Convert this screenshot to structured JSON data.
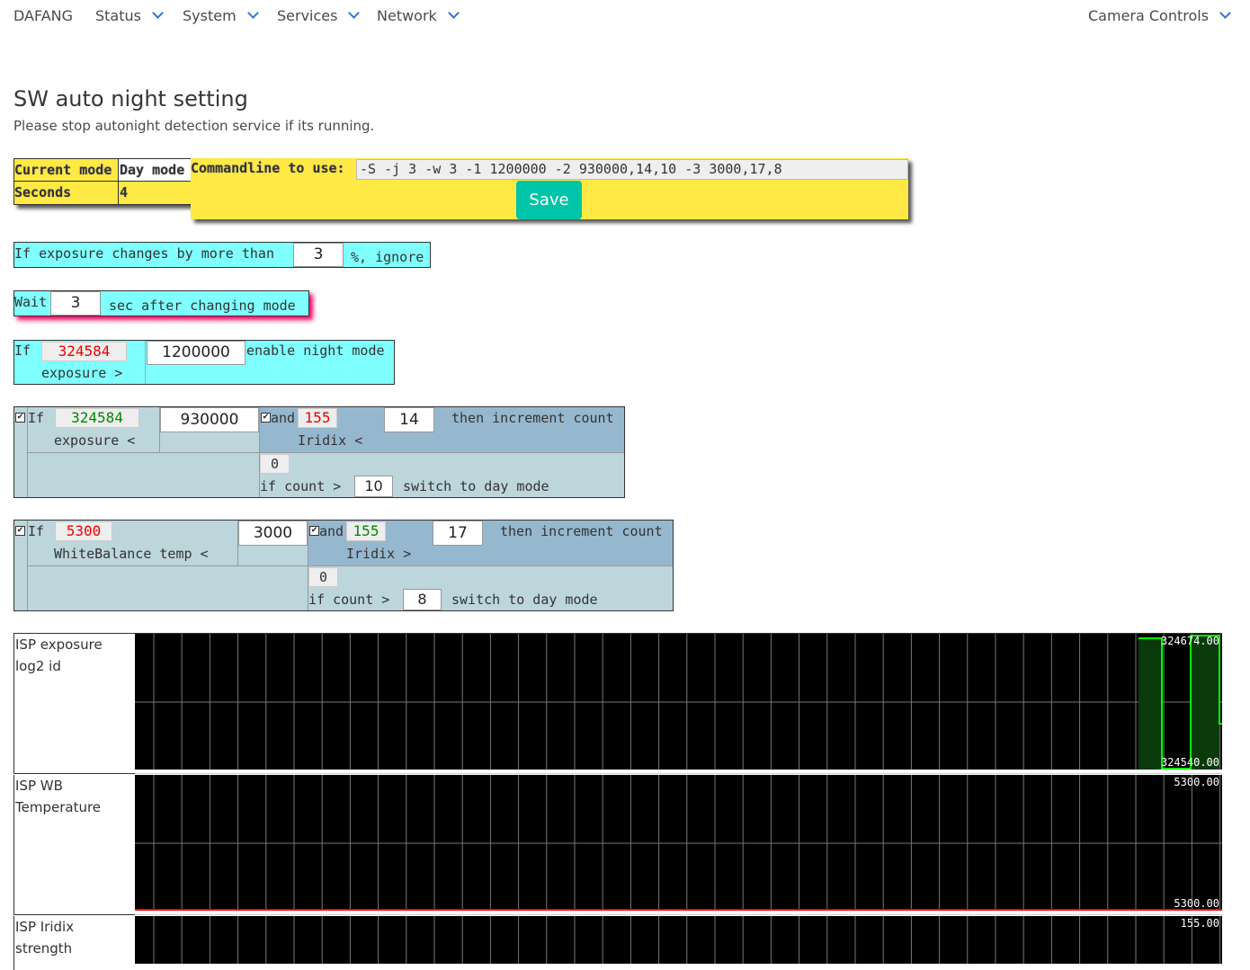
{
  "nav": {
    "brand": "DAFANG",
    "items": [
      "Status",
      "System",
      "Services",
      "Network"
    ],
    "right": "Camera Controls"
  },
  "page": {
    "title": "SW auto night setting",
    "subtitle": "Please stop autonight detection service if its running."
  },
  "mode_table": {
    "current_mode_label": "Current mode",
    "current_mode_value": "Day mode",
    "seconds_label": "Seconds",
    "seconds_value": "4"
  },
  "commandline": {
    "label": "Commandline to use:",
    "value": "-S -j 3 -w 3 -1 1200000 -2 930000,14,10 -3 3000,17,8",
    "save_label": "Save"
  },
  "exposure_change": {
    "prefix": "If exposure changes by more than",
    "value": "3",
    "suffix": "%, ignore"
  },
  "wait": {
    "prefix": "Wait",
    "value": "3",
    "suffix": "sec after changing mode"
  },
  "night_rule": {
    "if_label": "If",
    "current": "324584",
    "metric": "exposure >",
    "threshold": "1200000",
    "action": "enable night mode"
  },
  "day_rule_1": {
    "if_label": "If",
    "current": "324584",
    "metric": "exposure <",
    "threshold": "930000",
    "and_label": "and",
    "and_current": "155",
    "and_metric": "Iridix <",
    "and_threshold": "14",
    "then_label": "then increment count",
    "count": "0",
    "count_label": "if count >",
    "count_threshold": "10",
    "action": "switch to day mode"
  },
  "day_rule_2": {
    "if_label": "If",
    "current": "5300",
    "metric": "WhiteBalance temp <",
    "threshold": "3000",
    "and_label": "and",
    "and_current": "155",
    "and_metric": "Iridix >",
    "and_threshold": "17",
    "then_label": "then increment count",
    "count": "0",
    "count_label": "if count >",
    "count_threshold": "8",
    "action": "switch to day mode"
  },
  "charts": [
    {
      "label": "ISP exposure log2 id",
      "max_label": "324674.00",
      "min_label": "324540.00",
      "color": "#00ff00"
    },
    {
      "label": "ISP WB Temperature",
      "max_label": "5300.00",
      "min_label": "5300.00",
      "color": "#ff0000"
    },
    {
      "label": "ISP Iridix strength",
      "max_label": "155.00",
      "min_label": ""
    }
  ],
  "colors": {
    "accent": "#00c4a7",
    "link": "#3273dc",
    "yellow_panel": "#ffe944",
    "cyan_panel": "#80ffff",
    "blue_panel": "#96b8cf",
    "light_blue_panel": "#bcd6dc"
  }
}
